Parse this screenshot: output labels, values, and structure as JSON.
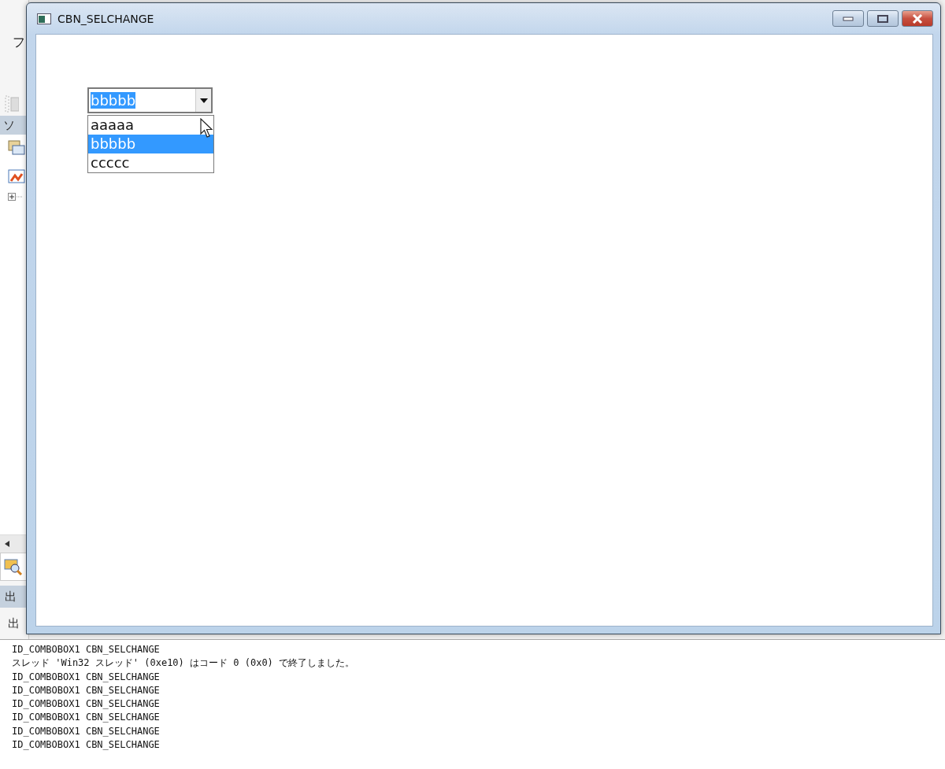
{
  "background_ide": {
    "menu_text": "フ",
    "solution_panel_title": "ソ",
    "output_panel_title": "出",
    "output_toolbar_label": "出"
  },
  "window": {
    "title": "CBN_SELCHANGE"
  },
  "combobox": {
    "value": "bbbbb",
    "focused": true,
    "expanded": true,
    "items": [
      {
        "label": "aaaaa",
        "selected": false
      },
      {
        "label": "bbbbb",
        "selected": true
      },
      {
        "label": "ccccc",
        "selected": false
      }
    ]
  },
  "output_lines": [
    "ID_COMBOBOX1 CBN_SELCHANGE",
    "スレッド 'Win32 スレッド' (0xe10) はコード 0 (0x0) で終了しました。",
    "ID_COMBOBOX1 CBN_SELCHANGE",
    "ID_COMBOBOX1 CBN_SELCHANGE",
    "ID_COMBOBOX1 CBN_SELCHANGE",
    "ID_COMBOBOX1 CBN_SELCHANGE",
    "ID_COMBOBOX1 CBN_SELCHANGE",
    "ID_COMBOBOX1 CBN_SELCHANGE"
  ]
}
